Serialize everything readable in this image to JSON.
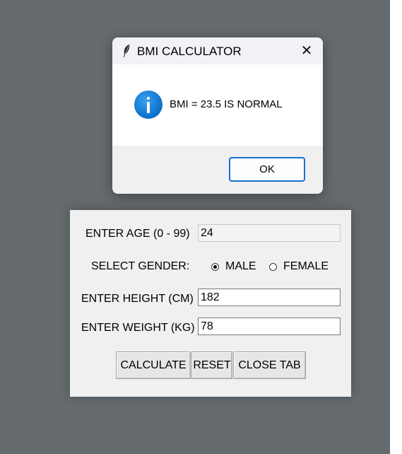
{
  "dialog": {
    "title": "BMI CALCULATOR",
    "close_glyph": "✕",
    "icon": "info-icon",
    "message": "BMI = 23.5 IS NORMAL",
    "ok_label": "OK"
  },
  "form": {
    "age_label": "ENTER AGE (0 - 99)",
    "age_value": "24",
    "gender_label": "SELECT GENDER:",
    "gender_options": [
      "MALE",
      "FEMALE"
    ],
    "gender_selected": "MALE",
    "height_label": "ENTER HEIGHT (CM)",
    "height_value": "182",
    "weight_label": "ENTER WEIGHT (KG)",
    "weight_value": "78"
  },
  "buttons": {
    "calculate": "CALCULATE",
    "reset": "RESET",
    "close_tab": "CLOSE TAB"
  },
  "colors": {
    "desktop": "#646a6e",
    "accent": "#1a6fd0",
    "info_icon": "#0a6fc8"
  }
}
